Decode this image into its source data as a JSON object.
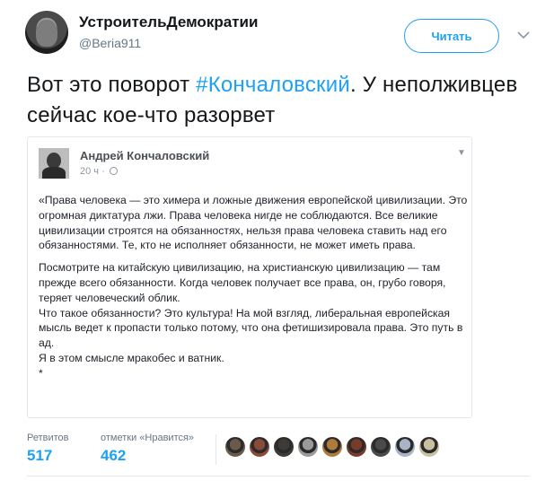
{
  "author": {
    "display_name": "УстроительДемократии",
    "handle": "@Beria911"
  },
  "follow_button": {
    "label": "Читать"
  },
  "tweet": {
    "text_before": "Вот это поворот ",
    "hashtag": "#Кончаловский",
    "text_after": ". У неполживцев сейчас кое-что разорвет"
  },
  "embedded_post": {
    "author": "Андрей Кончаловский",
    "time": "20 ч ·",
    "paragraphs": [
      "«Права человека — это химера и ложные движения европейской цивилизации. Это огромная диктатура лжи. Права человека нигде не соблюдаются. Все великие цивилизации строятся на обязанностях, нельзя права человека ставить над его обязанностями. Те, кто не исполняет обязанности, не может иметь права.",
      "Посмотрите на китайскую цивилизацию, на христианскую цивилизацию — там прежде всего обязанности. Когда человек получает все права, он, грубо говоря, теряет человеческий облик.\nЧто такое обязанности? Это культура! На мой взгляд, либеральная европейская мысль ведет к пропасти только потому, что она фетишизировала права. Это путь в ад.\nЯ в этом смысле мракобес и ватник.\n*"
    ]
  },
  "stats": {
    "retweets_label": "Ретвитов",
    "retweets_value": "517",
    "likes_label": "отметки «Нравится»",
    "likes_value": "462"
  },
  "liker_colors": [
    "#6b5a4a",
    "#8a4a3a",
    "#3e3a36",
    "#9a9a9a",
    "#b07a3a",
    "#7a3a2a",
    "#4a4a4a",
    "#a8b4c8",
    "#c8c0a0"
  ],
  "colors": {
    "accent": "#1da1f2",
    "text": "#14171a",
    "muted": "#657786"
  }
}
